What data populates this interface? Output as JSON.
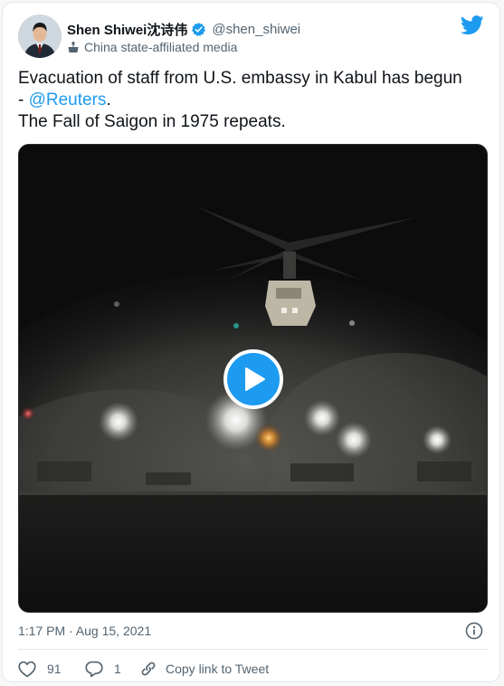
{
  "author": {
    "display_name": "Shen Shiwei沈诗伟",
    "handle": "@shen_shiwei",
    "affiliation": "China state-affiliated media",
    "verified_icon": "verified-badge-icon",
    "affiliation_icon": "podium-icon"
  },
  "tweet": {
    "text_line1": "Evacuation of staff from U.S. embassy in Kabul has begun",
    "text_dash": "- ",
    "mention": "@Reuters",
    "text_after_mention": ".",
    "text_line3": "The Fall of Saigon in 1975 repeats."
  },
  "media": {
    "type": "video",
    "play_icon": "play-icon"
  },
  "meta": {
    "timestamp": "1:17 PM · Aug 15, 2021"
  },
  "actions": {
    "like_count": "91",
    "reply_count": "1",
    "copy_link_label": "Copy link to Tweet"
  },
  "colors": {
    "accent": "#1d9bf0",
    "text": "#0f1419",
    "secondary": "#536471"
  }
}
